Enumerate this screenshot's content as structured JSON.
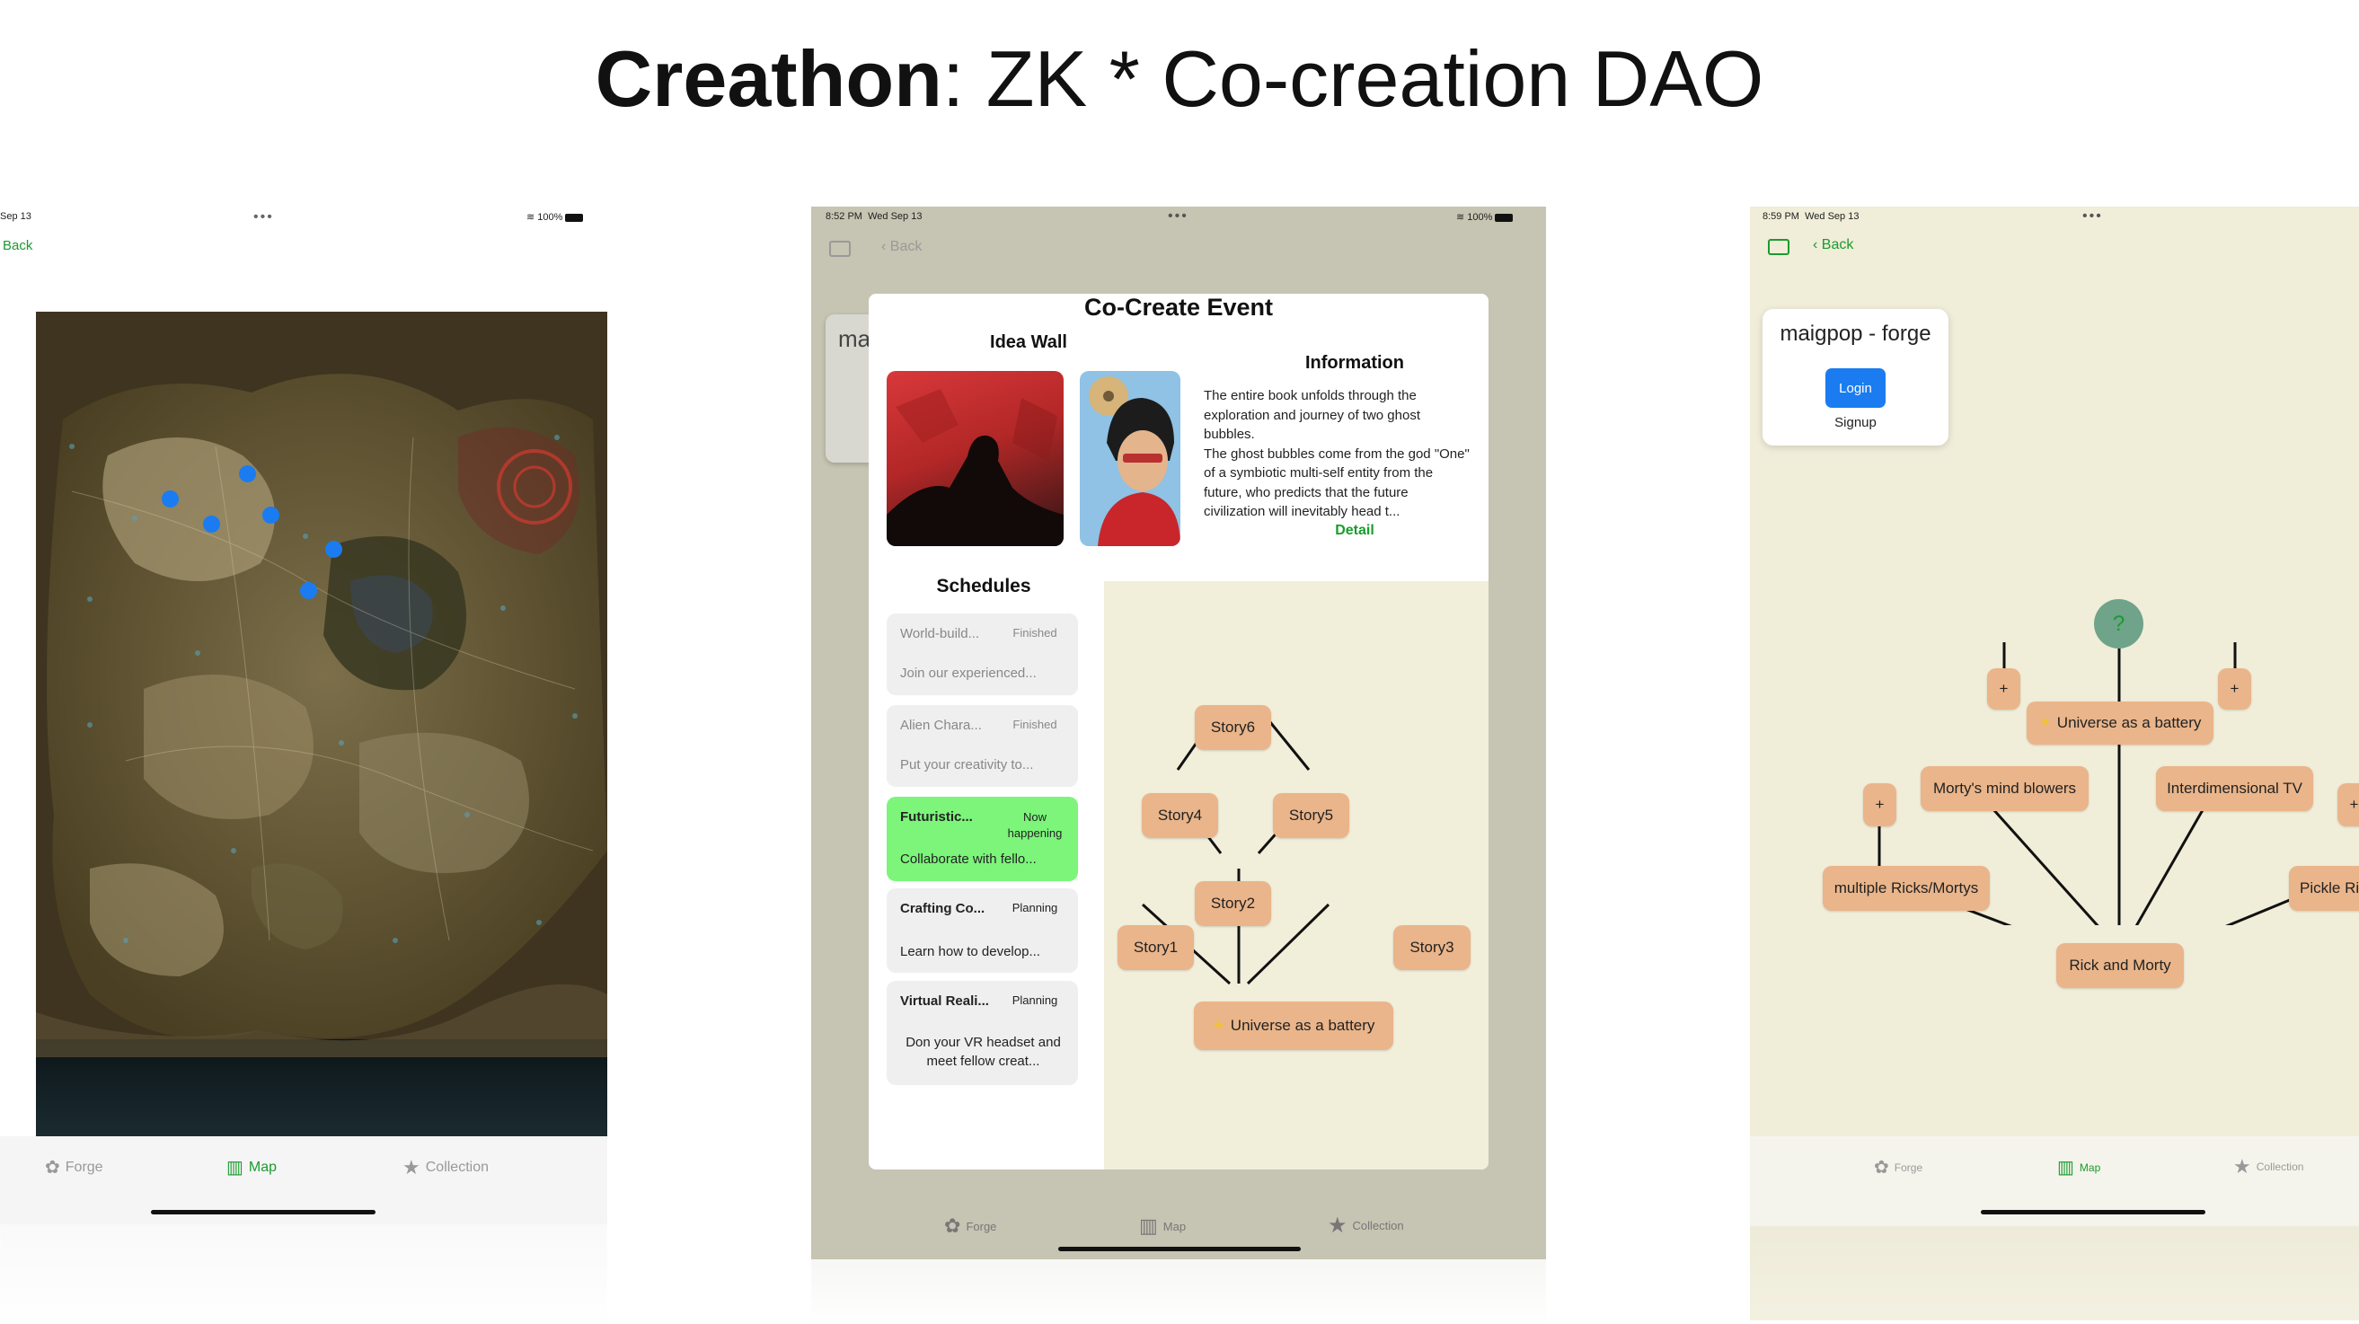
{
  "slide": {
    "title_bold": "Creathon",
    "title_rest": ": ZK * Co-creation DAO"
  },
  "phone1": {
    "status_date": "Sep 13",
    "battery": "100%",
    "back_label": "Back",
    "tabs": [
      {
        "label": "Forge",
        "icon": "forge-icon"
      },
      {
        "label": "Map",
        "icon": "map-icon",
        "active": true
      },
      {
        "label": "Collection",
        "icon": "star-icon"
      }
    ],
    "map_markers_color": "#1a7cf0"
  },
  "phone2": {
    "status_time": "8:52 PM",
    "status_date": "Wed Sep 13",
    "battery": "100%",
    "back_label": "Back",
    "behind_card_text": "ma",
    "modal": {
      "title": "Co-Create Event",
      "idea_wall_title": "Idea Wall",
      "information_title": "Information",
      "information_text": "The entire book unfolds through the exploration and journey of two ghost bubbles.\nThe ghost bubbles come from the god \"One\" of a symbiotic multi-self entity from the future, who predicts that the future civilization will inevitably head t...",
      "detail_link": "Detail",
      "schedules_title": "Schedules",
      "schedules": [
        {
          "title": "World-build...",
          "status": "Finished",
          "desc": "Join our experienced..."
        },
        {
          "title": "Alien Chara...",
          "status": "Finished",
          "desc": "Put your creativity to..."
        },
        {
          "title": "Futuristic...",
          "status": "Now happening",
          "desc": "Collaborate with fello..."
        },
        {
          "title": "Crafting Co...",
          "status": "Planning",
          "desc": "Learn how to develop..."
        },
        {
          "title": "Virtual Reali...",
          "status": "Planning",
          "desc": "Don your VR headset and meet fellow creat..."
        }
      ],
      "graph_nodes": {
        "story6": "Story6",
        "story4": "Story4",
        "story5": "Story5",
        "story2": "Story2",
        "story1": "Story1",
        "story3": "Story3",
        "root": "Universe as a battery"
      }
    },
    "tabs": [
      {
        "label": "Forge"
      },
      {
        "label": "Map"
      },
      {
        "label": "Collection"
      }
    ],
    "now_happening_color": "#7cf57a"
  },
  "phone3": {
    "status_time": "8:59 PM",
    "status_date": "Wed Sep 13",
    "back_label": "Back",
    "card_title": "maigpop - forge",
    "login_label": "Login",
    "signup_label": "Signup",
    "graph": {
      "question": "?",
      "plus": "+",
      "universe": "Universe as a battery",
      "mortys": "Morty's mind blowers",
      "interdimensional": "Interdimensional TV",
      "multiple": "multiple Ricks/Mortys",
      "pickle": "Pickle Ric",
      "root": "Rick and Morty"
    },
    "tabs": [
      {
        "label": "Forge"
      },
      {
        "label": "Map",
        "active": true
      },
      {
        "label": "Collection"
      }
    ]
  }
}
